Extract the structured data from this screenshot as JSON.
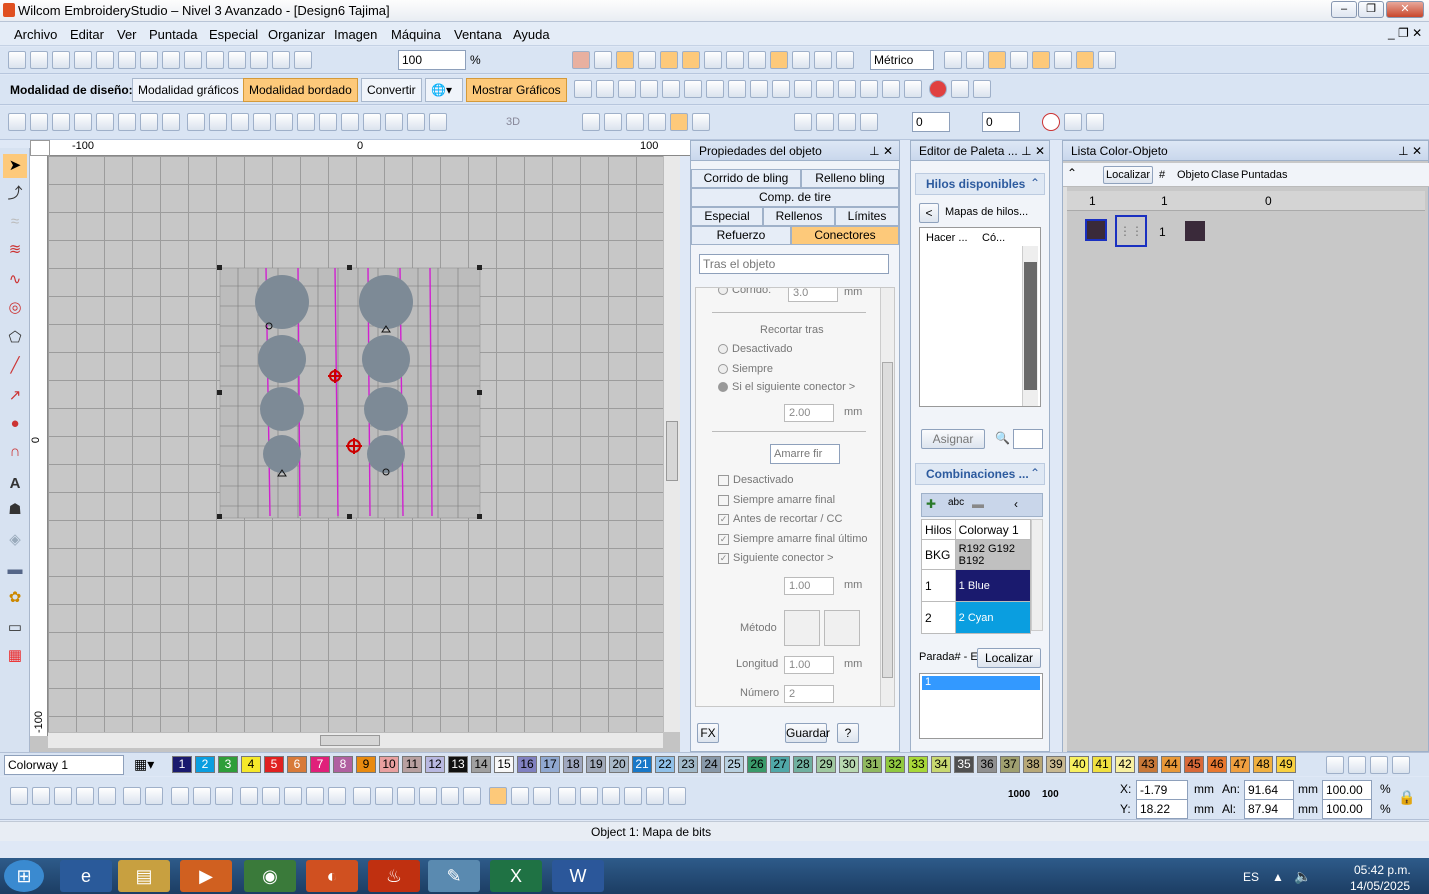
{
  "window": {
    "title": "Wilcom EmbroideryStudio – Nivel 3 Avanzado - [Design6          Tajima]"
  },
  "menu": [
    "Archivo",
    "Editar",
    "Ver",
    "Puntada",
    "Especial",
    "Organizar",
    "Imagen",
    "Máquina",
    "Ventana",
    "Ayuda"
  ],
  "toolbar1": {
    "zoom": "100",
    "zoom_unit": "%",
    "units": "Métrico"
  },
  "toolbar2": {
    "mode_label": "Modalidad de diseño:",
    "graphics_mode": "Modalidad gráficos",
    "embroidery_mode": "Modalidad bordado",
    "convert": "Convertir",
    "show_graphics": "Mostrar Gráficos"
  },
  "toolbar3": {
    "rotate_value": "0",
    "slant_value": "0",
    "label_3d": "3D"
  },
  "ruler": {
    "top": [
      "-100",
      "0",
      "100"
    ],
    "left": [
      "0",
      "-100"
    ]
  },
  "object_props": {
    "title": "Propiedades del objeto",
    "tabs": [
      "Corrido de bling",
      "Relleno bling",
      "Comp. de tire",
      "Especial",
      "Rellenos",
      "Límites",
      "Refuerzo",
      "Conectores"
    ],
    "dropdown": "Tras el objeto",
    "corrido_label": "Corrido:",
    "corrido_value": "3.0",
    "unit": "mm",
    "recortar_heading": "Recortar tras",
    "radios": [
      "Desactivado",
      "Siempre",
      "Si el siguiente conector >"
    ],
    "radio_value": "2.00",
    "amarre_dropdown": "Amarre fir",
    "checks": [
      "Desactivado",
      "Siempre amarre final",
      "Antes de recortar / CC",
      "Siempre amarre final último",
      "Siguiente conector >"
    ],
    "checks_value": "1.00",
    "metodo_label": "Método",
    "longitud_label": "Longitud",
    "longitud_value": "1.00",
    "numero_label": "Número",
    "numero_value": "2",
    "fx": "FX",
    "guardar": "Guardar",
    "help": "?"
  },
  "palette": {
    "title": "Editor de Paleta ...",
    "threads_title": "Hilos disponibles",
    "maps": "Mapas de hilos...",
    "cols": [
      "Hacer ...",
      "Có..."
    ],
    "assign": "Asignar",
    "combos_title": "Combinaciones ...",
    "table_head": [
      "Hilos",
      "Colorway 1"
    ],
    "rows": [
      {
        "id": "BKG",
        "color": "R192 G192 B192",
        "bg": "#c0c0c0",
        "fg": "#000000"
      },
      {
        "id": "1",
        "color": "1 Blue",
        "bg": "#1a1a6e",
        "fg": "#ffffff"
      },
      {
        "id": "2",
        "color": "2 Cyan",
        "bg": "#0a9ee0",
        "fg": "#ffffff"
      }
    ],
    "stop_label": "Parada# - E",
    "locate": "Localizar",
    "stop_list": [
      "1"
    ]
  },
  "colorobj": {
    "title": "Lista Color-Objeto",
    "locate": "Localizar",
    "hash": "#",
    "cols": [
      "Objeto",
      "Clase",
      "Puntadas"
    ],
    "row1": {
      "num": "1",
      "count": "1",
      "stitches": "0"
    },
    "row2": {
      "num": "1"
    }
  },
  "colorway": "Colorway 1",
  "swatches": [
    {
      "n": "1",
      "bg": "#1a1a6e",
      "fg": "#fff"
    },
    {
      "n": "2",
      "bg": "#0a9ee0",
      "fg": "#fff"
    },
    {
      "n": "3",
      "bg": "#2e9e3a",
      "fg": "#fff"
    },
    {
      "n": "4",
      "bg": "#f5e82a",
      "fg": "#000"
    },
    {
      "n": "5",
      "bg": "#e02020",
      "fg": "#fff"
    },
    {
      "n": "6",
      "bg": "#d87a3a",
      "fg": "#fff"
    },
    {
      "n": "7",
      "bg": "#e0207a",
      "fg": "#fff"
    },
    {
      "n": "8",
      "bg": "#b060a0",
      "fg": "#fff"
    },
    {
      "n": "9",
      "bg": "#e88a10",
      "fg": "#000"
    },
    {
      "n": "10",
      "bg": "#e8a0a0",
      "fg": "#000"
    },
    {
      "n": "11",
      "bg": "#b8a0a0",
      "fg": "#000"
    },
    {
      "n": "12",
      "bg": "#b8b8e0",
      "fg": "#000"
    },
    {
      "n": "13",
      "bg": "#101010",
      "fg": "#fff"
    },
    {
      "n": "14",
      "bg": "#a0a0a0",
      "fg": "#000"
    },
    {
      "n": "15",
      "bg": "#f8f8f8",
      "fg": "#000"
    },
    {
      "n": "16",
      "bg": "#8080c0",
      "fg": "#000"
    },
    {
      "n": "17",
      "bg": "#90a8d0",
      "fg": "#000"
    },
    {
      "n": "18",
      "bg": "#a0a8c0",
      "fg": "#000"
    },
    {
      "n": "19",
      "bg": "#a0a8b8",
      "fg": "#000"
    },
    {
      "n": "20",
      "bg": "#a8b8c8",
      "fg": "#000"
    },
    {
      "n": "21",
      "bg": "#1878c8",
      "fg": "#fff"
    },
    {
      "n": "22",
      "bg": "#90c0e8",
      "fg": "#000"
    },
    {
      "n": "23",
      "bg": "#a0b8c8",
      "fg": "#000"
    },
    {
      "n": "24",
      "bg": "#8898a8",
      "fg": "#000"
    },
    {
      "n": "25",
      "bg": "#b8d0e0",
      "fg": "#000"
    },
    {
      "n": "26",
      "bg": "#3a9a6a",
      "fg": "#000"
    },
    {
      "n": "27",
      "bg": "#50a8a8",
      "fg": "#000"
    },
    {
      "n": "28",
      "bg": "#70b0a0",
      "fg": "#000"
    },
    {
      "n": "29",
      "bg": "#a0c8a0",
      "fg": "#000"
    },
    {
      "n": "30",
      "bg": "#b8d8b0",
      "fg": "#000"
    },
    {
      "n": "31",
      "bg": "#90b860",
      "fg": "#000"
    },
    {
      "n": "32",
      "bg": "#90c840",
      "fg": "#000"
    },
    {
      "n": "33",
      "bg": "#a8d838",
      "fg": "#000"
    },
    {
      "n": "34",
      "bg": "#c8d870",
      "fg": "#000"
    },
    {
      "n": "35",
      "bg": "#505050",
      "fg": "#fff"
    },
    {
      "n": "36",
      "bg": "#909090",
      "fg": "#000"
    },
    {
      "n": "37",
      "bg": "#a0a070",
      "fg": "#000"
    },
    {
      "n": "38",
      "bg": "#b8a878",
      "fg": "#000"
    },
    {
      "n": "39",
      "bg": "#c8b890",
      "fg": "#000"
    },
    {
      "n": "40",
      "bg": "#f8f060",
      "fg": "#000"
    },
    {
      "n": "41",
      "bg": "#f0e040",
      "fg": "#000"
    },
    {
      "n": "42",
      "bg": "#f8f0a0",
      "fg": "#000"
    },
    {
      "n": "43",
      "bg": "#c87838",
      "fg": "#000"
    },
    {
      "n": "44",
      "bg": "#e89838",
      "fg": "#000"
    },
    {
      "n": "45",
      "bg": "#d86838",
      "fg": "#000"
    },
    {
      "n": "46",
      "bg": "#e87830",
      "fg": "#000"
    },
    {
      "n": "47",
      "bg": "#f0a040",
      "fg": "#000"
    },
    {
      "n": "48",
      "bg": "#f0b040",
      "fg": "#000"
    },
    {
      "n": "49",
      "bg": "#f8d040",
      "fg": "#000"
    }
  ],
  "coords": {
    "x_label": "X:",
    "x": "-1.79",
    "y_label": "Y:",
    "y": "18.22",
    "w_label": "An:",
    "w": "91.64",
    "h_label": "Al:",
    "h": "87.94",
    "unit": "mm",
    "pct_w": "100.00",
    "pct_h": "100.00",
    "pct": "%",
    "n1000": "1000",
    "n100": "100"
  },
  "status": {
    "object": "Object 1: Mapa de bits"
  },
  "taskbar": {
    "lang": "ES",
    "time": "05:42 p.m.",
    "date": "14/05/2025"
  }
}
